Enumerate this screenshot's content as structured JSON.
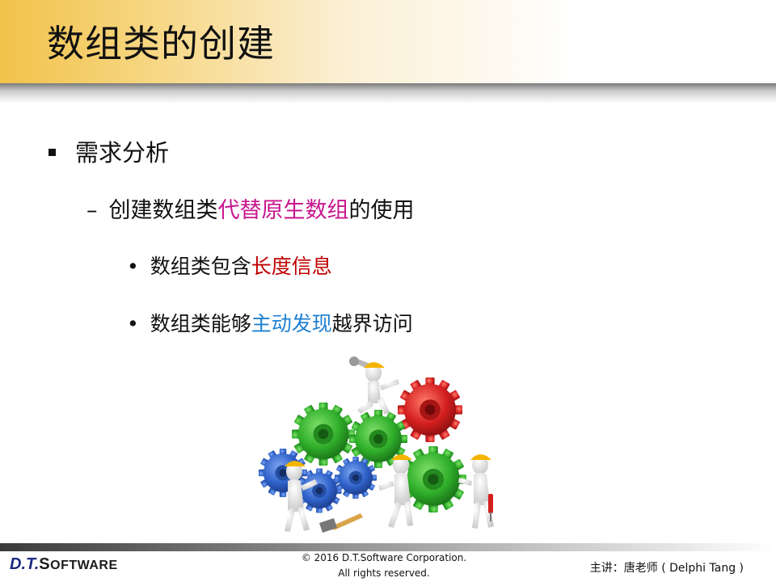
{
  "slide": {
    "title": "数组类的创建"
  },
  "content": {
    "level1": {
      "text": "需求分析"
    },
    "level2": {
      "marker": "–",
      "pre": "创建数组类",
      "highlight": "代替原生数组",
      "post": "的使用"
    },
    "level3a": {
      "marker": "•",
      "pre": "数组类包含",
      "highlight": "长度信息"
    },
    "level3b": {
      "marker": "•",
      "pre": "数组类能够",
      "highlight": "主动发现",
      "post": "越界访问"
    }
  },
  "footer": {
    "logo_dt": "D.T.",
    "logo_software_s": "S",
    "logo_software_rest": "OFTWARE",
    "copyright_line1": "© 2016 D.T.Software Corporation.",
    "copyright_line2": "All rights reserved.",
    "lecturer": "主讲：唐老师 ( Delphi Tang )"
  },
  "colors": {
    "title_band": "#f2c24a",
    "highlight_magenta": "#c8168e",
    "highlight_red": "#c00000",
    "highlight_blue": "#1f7fd1",
    "gear_blue": "#2f62c9",
    "gear_green": "#2fae2a",
    "gear_red": "#d41f1f",
    "hard_hat": "#f5b400"
  },
  "illustration": {
    "icon": "gears-teamwork-illustration"
  }
}
